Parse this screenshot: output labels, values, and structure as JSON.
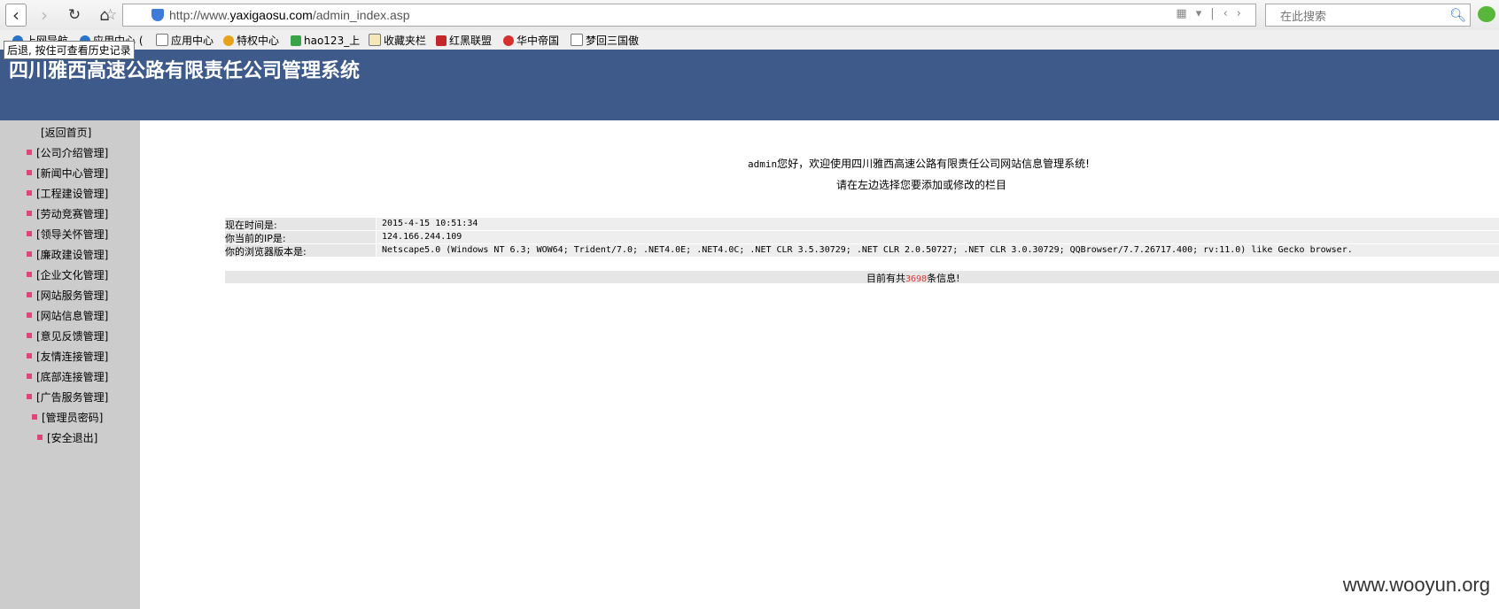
{
  "browser": {
    "url_prefix": "http://www.",
    "url_domain": "yaxigaosu.com",
    "url_path": "/admin_index.asp",
    "search_placeholder": "在此搜索",
    "back_tooltip": "后退, 按住可查看历史记录",
    "bookmarks": [
      {
        "label": "上网导航",
        "icon_color": "#2a74c8"
      },
      {
        "label": "应用中心 (",
        "icon_color": "#2a74c8"
      },
      {
        "label": "应用中心",
        "icon_color": "#ffffff"
      },
      {
        "label": "特权中心",
        "icon_color": "#e8a21a"
      },
      {
        "label": "hao123_上",
        "icon_color": "#3aa34a"
      },
      {
        "label": "收藏夹栏",
        "icon_color": "#ffffff"
      },
      {
        "label": "红黑联盟",
        "icon_color": "#c4262b"
      },
      {
        "label": "华中帝国",
        "icon_color": "#d3302f"
      },
      {
        "label": "梦回三国傲",
        "icon_color": "#ffffff"
      }
    ]
  },
  "header": {
    "title": "四川雅西高速公路有限责任公司管理系统"
  },
  "sidebar": {
    "home": "[返回首页]",
    "items": [
      "[公司介绍管理]",
      "[新闻中心管理]",
      "[工程建设管理]",
      "[劳动竞赛管理]",
      "[领导关怀管理]",
      "[廉政建设管理]",
      "[企业文化管理]",
      "[网站服务管理]",
      "[网站信息管理]",
      "[意见反馈管理]",
      "[友情连接管理]",
      "[底部连接管理]",
      "[广告服务管理]",
      "[管理员密码]",
      "[安全退出]"
    ]
  },
  "main": {
    "welcome_user": "admin",
    "welcome_text": "您好，欢迎使用四川雅西高速公路有限责任公司网站信息管理系统!",
    "instruction": "请在左边选择您要添加或修改的栏目",
    "info": [
      {
        "label": "现在时间是:",
        "value": "2015-4-15 10:51:34"
      },
      {
        "label": "你当前的IP是:",
        "value": "124.166.244.109"
      },
      {
        "label": "你的浏览器版本是:",
        "value": "Netscape5.0 (Windows NT 6.3; WOW64; Trident/7.0; .NET4.0E; .NET4.0C; .NET CLR 3.5.30729; .NET CLR 2.0.50727; .NET CLR 3.0.30729; QQBrowser/7.7.26717.400; rv:11.0) like Gecko browser."
      }
    ],
    "count_prefix": "目前有共",
    "count_value": "3698",
    "count_suffix": "条信息!"
  },
  "watermark": "www.wooyun.org",
  "colors": {
    "header_bg": "#3d5a8a",
    "sidebar_bg": "#cccccc",
    "bullet": "#e0457a",
    "count": "#e53333"
  }
}
